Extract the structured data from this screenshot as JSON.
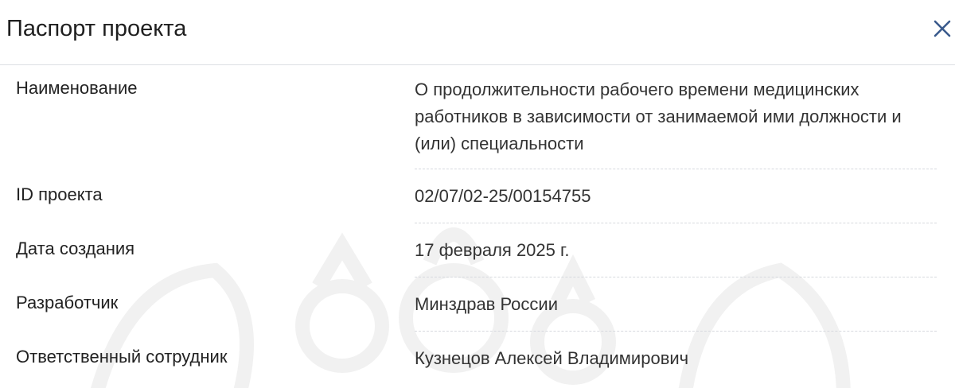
{
  "dialog": {
    "title": "Паспорт проекта",
    "close_icon": "close-icon",
    "accent_color": "#3a5a8c"
  },
  "fields": [
    {
      "label": "Наименование",
      "value": "О продолжительности рабочего времени медицинских работников в зависимости от занимаемой ими должности и (или) специальности"
    },
    {
      "label": "ID проекта",
      "value": "02/07/02-25/00154755"
    },
    {
      "label": "Дата создания",
      "value": "17 февраля 2025 г."
    },
    {
      "label": "Разработчик",
      "value": "Минздрав России"
    },
    {
      "label": "Ответственный сотрудник",
      "value": "Кузнецов Алексей Владимирович"
    }
  ]
}
